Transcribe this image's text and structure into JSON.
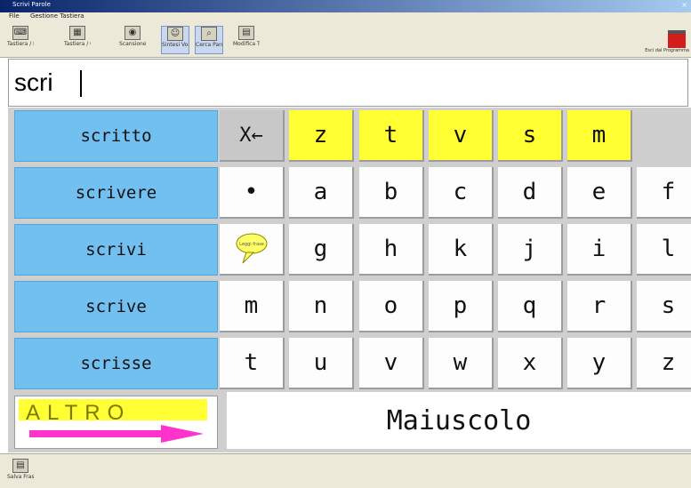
{
  "window": {
    "title": "Scrivi Parole"
  },
  "menu": [
    "File",
    "Gestione Tastiera"
  ],
  "toolbar": {
    "buttons": [
      {
        "icon": "keyboard-icon",
        "glyph": "⌨",
        "label": "Tastiera / Parole"
      },
      {
        "icon": "layout-icon",
        "glyph": "▦",
        "label": "Tastiera / Caratteri"
      },
      {
        "icon": "speaker-icon",
        "glyph": "◉",
        "label": "Scansione / Passo Passo"
      },
      {
        "icon": "speech-bubble-icon",
        "glyph": "☺",
        "label": "Sintesi Vocale"
      },
      {
        "icon": "search-icon",
        "glyph": "⌕",
        "label": "Cerca Parola"
      },
      {
        "icon": "document-icon",
        "glyph": "▤",
        "label": "Modifica Tastiera"
      }
    ],
    "exit_label": "Esci dal Programma"
  },
  "input": {
    "text": "scri"
  },
  "suggestions": [
    "scritto",
    "scrivere",
    "scrivi",
    "scrive",
    "scrisse"
  ],
  "keyboard": {
    "row1": [
      "z",
      "t",
      "v",
      "s",
      "m"
    ],
    "backspace_symbol": "X←",
    "dot": "•",
    "speak_label": "Leggi frase",
    "letters": [
      [
        "a",
        "b",
        "c",
        "d",
        "e",
        "f"
      ],
      [
        "g",
        "h",
        "k",
        "j",
        "i",
        "l"
      ],
      [
        "m",
        "n",
        "o",
        "p",
        "q",
        "r",
        "s"
      ],
      [
        "t",
        "u",
        "v",
        "w",
        "x",
        "y",
        "z"
      ]
    ],
    "shift_label": "Maiuscolo"
  },
  "altro": {
    "label": "ALTRO"
  },
  "statusbar": {
    "label": "Salva Frase"
  },
  "colors": {
    "suggestion_bg": "#72c0f0",
    "highlight": "#ffff33",
    "arrow": "#ff33cc"
  }
}
